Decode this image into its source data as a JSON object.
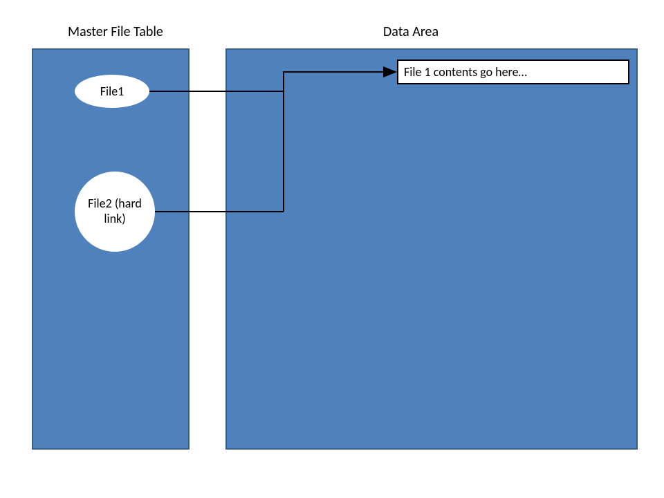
{
  "labels": {
    "mft": "Master File Table",
    "data_area": "Data Area"
  },
  "nodes": {
    "file1": "File1",
    "file2": "File2 (hard link)",
    "contents": "File 1 contents go here…"
  }
}
